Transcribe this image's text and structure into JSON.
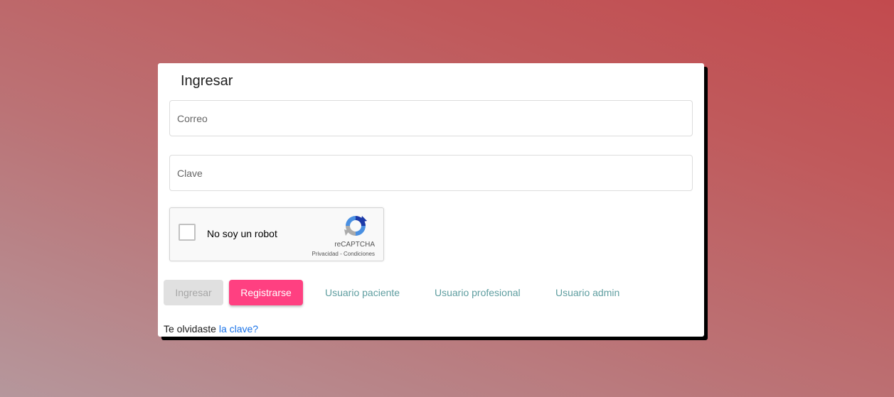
{
  "login": {
    "title": "Ingresar",
    "email_placeholder": "Correo",
    "password_placeholder": "Clave"
  },
  "captcha": {
    "label": "No soy un robot",
    "brand": "reCAPTCHA",
    "privacy": "Privacidad",
    "separator": " - ",
    "terms": "Condiciones"
  },
  "actions": {
    "login_label": "Ingresar",
    "register_label": "Registrarse",
    "patient_label": "Usuario paciente",
    "professional_label": "Usuario profesional",
    "admin_label": "Usuario admin"
  },
  "forgot": {
    "prefix": "Te olvidaste ",
    "link": "la clave?"
  },
  "colors": {
    "accent": "#ff4081",
    "link": "#5f9ea0",
    "forgot_link": "#1a73e8",
    "disabled_bg": "#e0e0e0"
  }
}
